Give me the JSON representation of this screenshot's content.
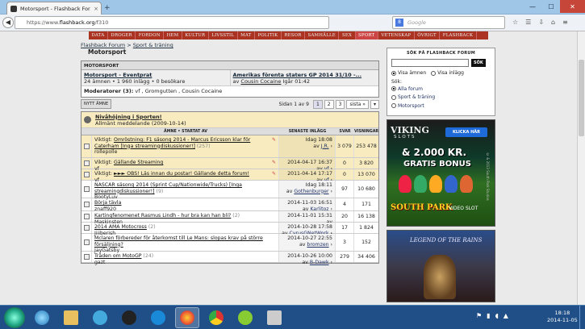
{
  "browser": {
    "tab_title": "Motorsport - Flashback For...",
    "tab_close": "×",
    "new_tab": "+",
    "url_prefix": "https://www.",
    "url_domain": "flashback.org",
    "url_path": "/f310",
    "search_placeholder": "Google",
    "search_engine_glyph": "8",
    "win_min": "—",
    "win_max": "☐",
    "win_close": "✕"
  },
  "menu": [
    "DATA",
    "DROGER",
    "FORDON",
    "HEM",
    "KULTUR",
    "LIVSSTIL",
    "MAT",
    "POLITIK",
    "RESOR",
    "SAMHÄLLE",
    "SEX",
    "SPORT",
    "VETENSKAP",
    "ÖVRIGT",
    "FLASHBACK"
  ],
  "menu_active": "SPORT",
  "breadcrumb": {
    "home": "Flashback Forum",
    "sep": " > ",
    "parent": "Sport & träning"
  },
  "forum_title": "Motorsport",
  "section_header": "MOTORSPORT",
  "subforums": [
    {
      "title": "Motorsport - Eventprat",
      "stats": "24 ämnen • 1 960 inlägg • 0 besökare"
    },
    {
      "title": "Amerikas förenta staters GP 2014 31/10 -...",
      "by": "av ",
      "user": "Cousin Cocaine",
      "time": " Igår 01:42"
    }
  ],
  "moderators": {
    "label": "Moderatorer (3):",
    "names": " vf , Gromgutten , Cousin Cocaine"
  },
  "pager": {
    "new_topic": "NYTT ÄMNE",
    "page_of": "Sidan 1 av 9",
    "pages": [
      "1",
      "2",
      "3"
    ],
    "next": "sista »",
    "menu_glyph": "▾"
  },
  "announcement": {
    "title": "Nivåhöjning i Sporten!",
    "sub": "Allmänt meddelande",
    "date": "(2009-10-14)"
  },
  "columns": {
    "topic": "ÄMNE • STARTAT AV",
    "last": "SENASTE INLÄGG",
    "replies": "SVAR",
    "views": "VISNINGAR"
  },
  "threads": [
    {
      "prefix": "Viktigt: ",
      "title": "Omröstning: F1 säsong 2014 - Marcus Ericsson klar för Caterham [Inga streamingdiskussioner!]",
      "count": " (257)",
      "starter": "rollepolle",
      "date": "Idag 18:08",
      "by": "av ",
      "user": "J.R.",
      "arrow": " ›",
      "replies": "3 079",
      "views": "253 478",
      "sticky": true
    },
    {
      "prefix": "Viktigt: ",
      "title": "Gällande Streaming",
      "count": "",
      "starter": "vf",
      "date": "2014-04-17 16:37",
      "by": "av ",
      "user": "vf",
      "arrow": " ›",
      "replies": "0",
      "views": "3 820",
      "sticky": true
    },
    {
      "prefix": "Viktigt: ",
      "title": "►►► OBS! Läs innan du postar! Gällande detta forum!",
      "count": "",
      "starter": "vf",
      "date": "2011-04-14 17:17",
      "by": "av ",
      "user": "vf",
      "arrow": " ›",
      "replies": "0",
      "views": "13 070",
      "sticky": true
    },
    {
      "prefix": "",
      "title": "NASCAR säsong 2014 (Sprint Cup/Nationwide/Trucks) [Inga streamingdiskussioner!]",
      "count": " (9)",
      "starter": "BootyLuv",
      "date": "Idag 18:11",
      "by": "av ",
      "user": "Gothenburger",
      "arrow": " ›",
      "replies": "97",
      "views": "10 680",
      "sticky": false
    },
    {
      "prefix": "",
      "title": "Börja tävla",
      "count": "",
      "starter": "znaff920",
      "date": "2014-11-03 16:51",
      "by": "av ",
      "user": "Karlitoz",
      "arrow": " ›",
      "replies": "4",
      "views": "171",
      "sticky": false
    },
    {
      "prefix": "",
      "title": "Kartingfenomenet Rasmus Lindh - hur bra kan han bli?",
      "count": " (2)",
      "starter": "Maskinsten",
      "date": "2014-11-01 15:31",
      "by": "av ",
      "user": "Anonymarægrabben",
      "arrow": " ›",
      "replies": "20",
      "views": "16 138",
      "sticky": false
    },
    {
      "prefix": "",
      "title": "2014 AMA Motocross",
      "count": " (2)",
      "starter": "Jiiiberish",
      "date": "2014-10-28 17:58",
      "by": "av ",
      "user": "CyrusGNetWork",
      "arrow": " ›",
      "replies": "17",
      "views": "1 824",
      "sticky": false
    },
    {
      "prefix": "",
      "title": "Mclaren förbereder för återkomst till Le Mans: slopas krav på större försäljning?",
      "count": "",
      "starter": "JayGatsby",
      "date": "2014-10-27 22:55",
      "by": "av ",
      "user": "bromzen",
      "arrow": " ›",
      "replies": "3",
      "views": "152",
      "sticky": false
    },
    {
      "prefix": "",
      "title": "Tråden om MotoGP",
      "count": " (24)",
      "starter": "gazt",
      "date": "2014-10-26 10:00",
      "by": "av ",
      "user": "B-Dawk",
      "arrow": " ›",
      "replies": "279",
      "views": "34 406",
      "sticky": false
    }
  ],
  "sidebar": {
    "search_title": "SÖK PÅ FLASHBACK FORUM",
    "search_button": "SÖK",
    "opt_topics": "Visa ämnen",
    "opt_posts": "Visa inlägg",
    "scope_label": "Sök:",
    "scopes": [
      "Alla forum",
      "Sport & träning",
      "Motorsport"
    ]
  },
  "ad1": {
    "brand": "VIKING",
    "sub": "SLOTS",
    "cta": "KLICKA HÄR",
    "amount": "& 2.000 KR.",
    "gratis": "GRATIS BONUS",
    "show": "SOUTH PARK",
    "slot": "VIDEO SLOT",
    "copyright": "© & 2013 South Park Studios"
  },
  "ad2": {
    "title": "LEGEND OF THE RAINS"
  },
  "taskbar": {
    "time": "18:18",
    "date": "2014-11-05"
  },
  "colors": {
    "menu": "#a33322",
    "sticky": "#f7ebbf",
    "taskbar": "#1f4f86"
  }
}
